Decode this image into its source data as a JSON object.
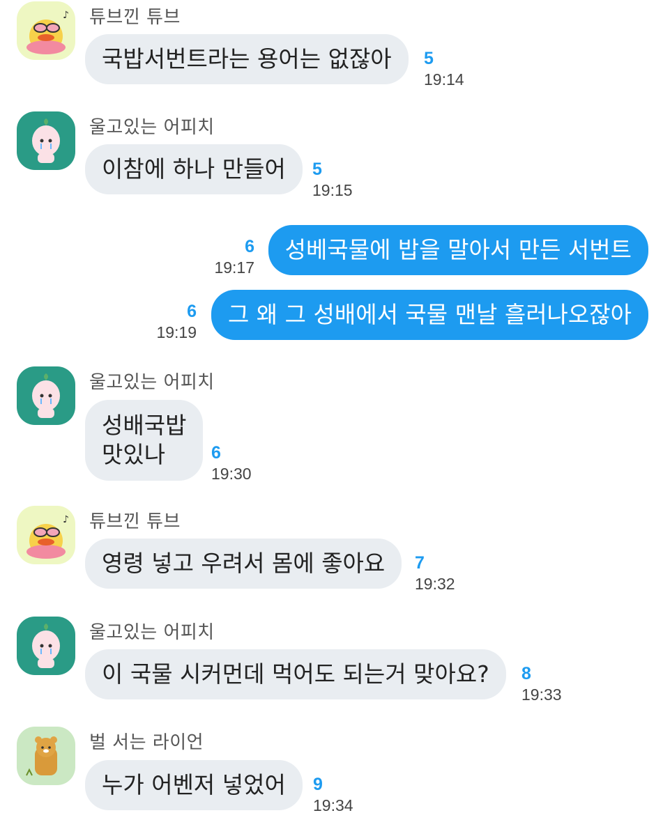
{
  "messages": [
    {
      "sender": "튜브낀 튜브",
      "avatar": "tube-duck-avatar",
      "text": "국밥서번트라는 용어는 없잖아",
      "count": "5",
      "time": "19:14",
      "mine": false
    },
    {
      "sender": "울고있는 어피치",
      "avatar": "crying-apeach-avatar",
      "text": "이참에 하나 만들어",
      "count": "5",
      "time": "19:15",
      "mine": false
    },
    {
      "text": "성베국물에 밥을 말아서 만든 서번트",
      "count": "6",
      "time": "19:17",
      "mine": true
    },
    {
      "text": "그 왜 그 성배에서 국물 맨날 흘러나오잖아",
      "count": "6",
      "time": "19:19",
      "mine": true
    },
    {
      "sender": "울고있는 어피치",
      "avatar": "crying-apeach-avatar",
      "lines": [
        "성배국밥",
        "맛있나"
      ],
      "count": "6",
      "time": "19:30",
      "mine": false
    },
    {
      "sender": "튜브낀 튜브",
      "avatar": "tube-duck-avatar",
      "text": "영령 넣고 우려서 몸에 좋아요",
      "count": "7",
      "time": "19:32",
      "mine": false
    },
    {
      "sender": "울고있는 어피치",
      "avatar": "crying-apeach-avatar",
      "text": "이 국물 시커먼데 먹어도 되는거 맞아요?",
      "count": "8",
      "time": "19:33",
      "mine": false
    },
    {
      "sender": "벌 서는 라이언",
      "avatar": "punished-ryan-avatar",
      "text": "누가 어벤저 넣었어",
      "count": "9",
      "time": "19:34",
      "mine": false
    }
  ],
  "colors": {
    "my_bubble": "#1d9bf0",
    "other_bubble": "#e9edf1",
    "unread_count": "#1d9bf0"
  }
}
